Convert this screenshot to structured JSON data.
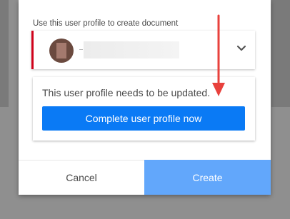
{
  "profile_selector": {
    "label": "Use this user profile to create document",
    "selected_name": ""
  },
  "warning": {
    "message": "This user profile needs to be updated.",
    "action_label": "Complete user profile now"
  },
  "footer": {
    "cancel_label": "Cancel",
    "create_label": "Create"
  },
  "colors": {
    "primary": "#0a7af5",
    "create_button": "#62a7fb",
    "error_accent": "#d0021b",
    "annotation": "#e8413c"
  },
  "icons": {
    "dropdown": "chevron-down-icon",
    "annotation": "arrow-down-icon"
  }
}
